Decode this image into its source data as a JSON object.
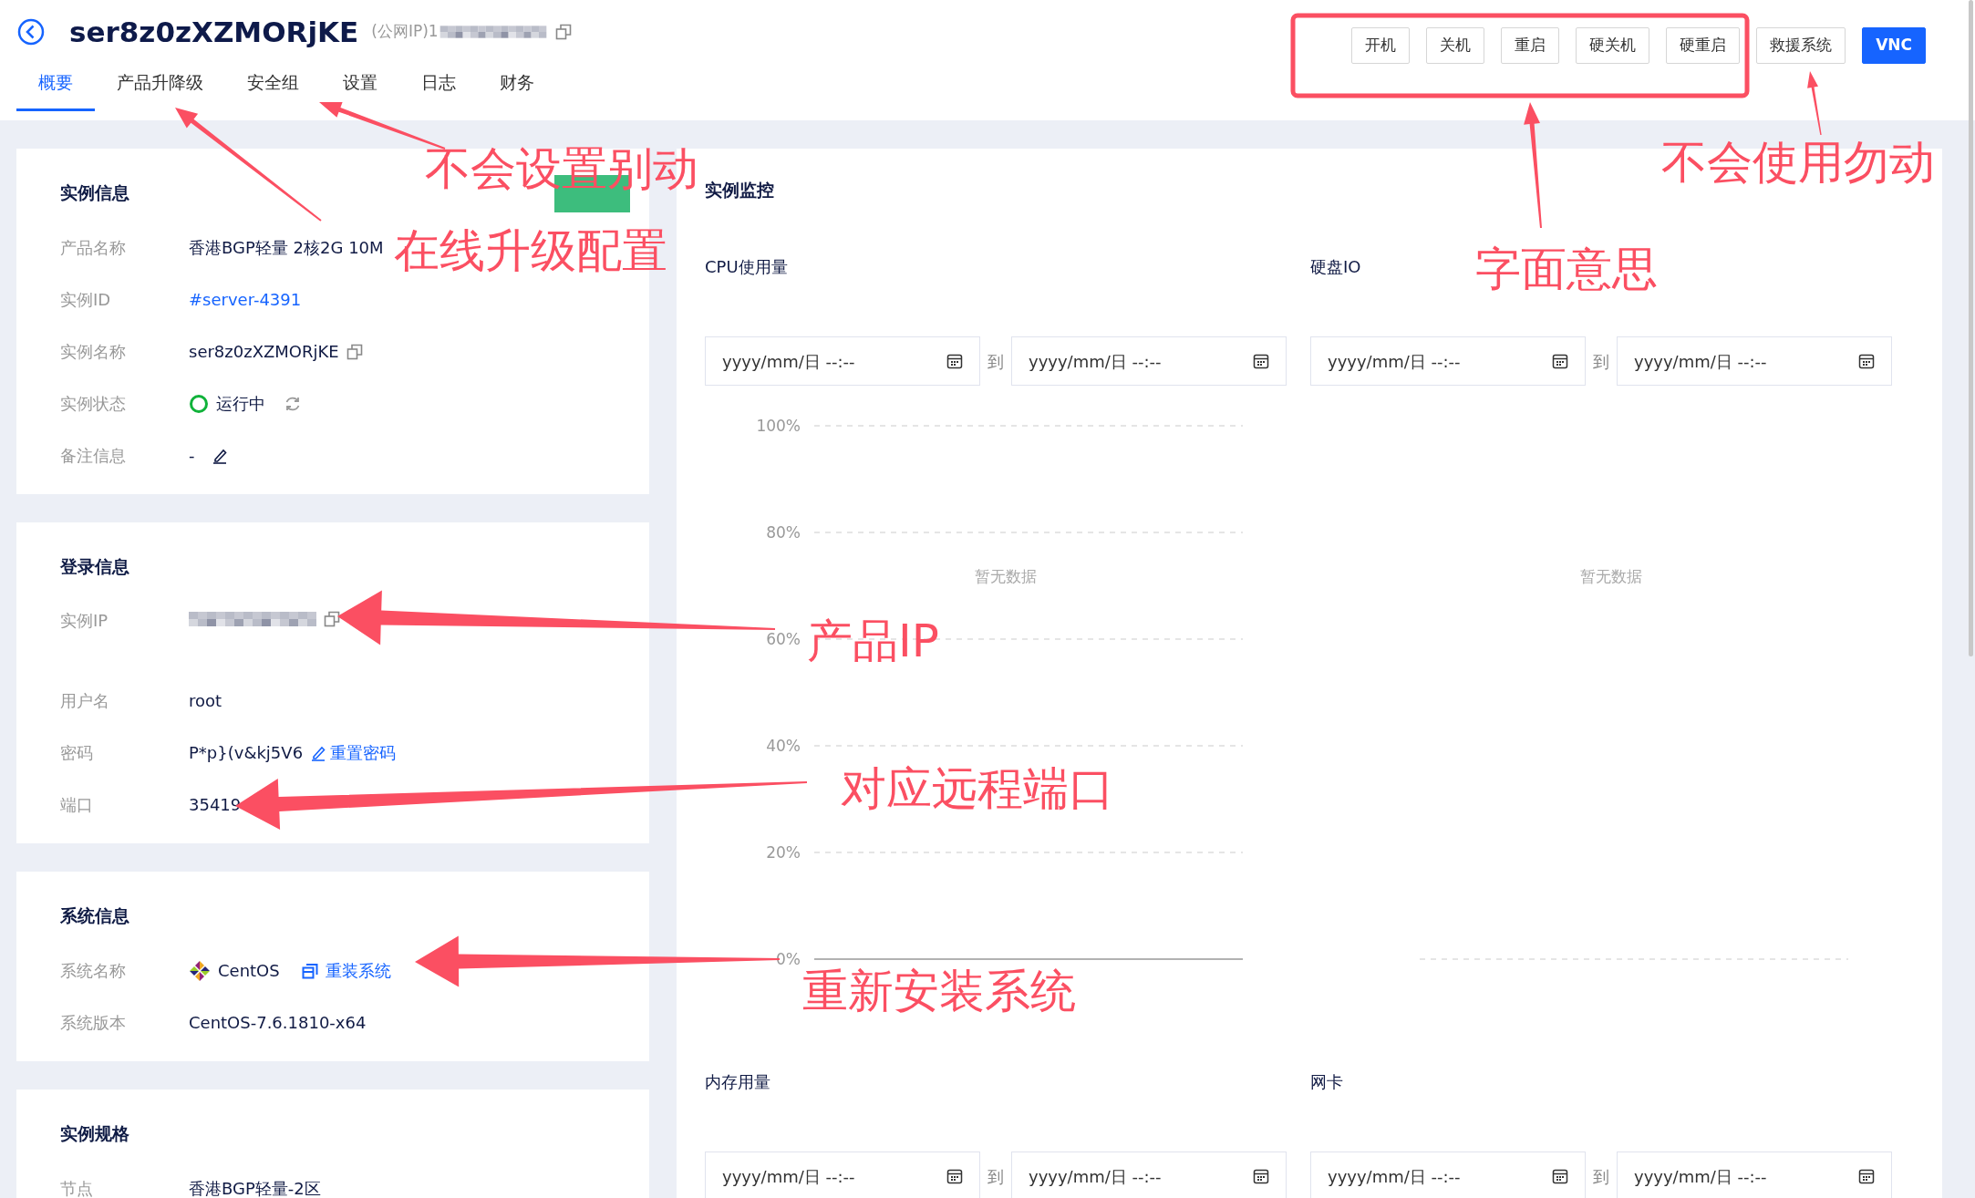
{
  "header": {
    "title": "ser8z0zXZMORjKE",
    "subtitle": "(公网IP)1"
  },
  "tabs": [
    {
      "label": "概要",
      "selected": true
    },
    {
      "label": "产品升降级",
      "selected": false
    },
    {
      "label": "安全组",
      "selected": false
    },
    {
      "label": "设置",
      "selected": false
    },
    {
      "label": "日志",
      "selected": false
    },
    {
      "label": "财务",
      "selected": false
    }
  ],
  "actions": [
    {
      "label": "开机",
      "kind": "default"
    },
    {
      "label": "关机",
      "kind": "default"
    },
    {
      "label": "重启",
      "kind": "default"
    },
    {
      "label": "硬关机",
      "kind": "default"
    },
    {
      "label": "硬重启",
      "kind": "default"
    },
    {
      "label": "救援系统",
      "kind": "default"
    },
    {
      "label": "VNC",
      "kind": "primary"
    }
  ],
  "cards": [
    {
      "title": "实例信息",
      "badge": true,
      "rows": [
        {
          "label": "产品名称",
          "kind": "text",
          "value": "香港BGP轻量 2核2G 10M"
        },
        {
          "label": "实例ID",
          "kind": "link",
          "value": "#server-4391"
        },
        {
          "label": "实例名称",
          "kind": "copy",
          "value": "ser8z0zXZMORjKE"
        },
        {
          "label": "实例状态",
          "kind": "status",
          "value": "运行中",
          "active": true
        },
        {
          "label": "备注信息",
          "kind": "edit",
          "value": "-"
        }
      ]
    },
    {
      "title": "登录信息",
      "rows": [
        {
          "label": "实例IP",
          "kind": "blurred"
        },
        {
          "label": "用户名",
          "kind": "text",
          "value": "root"
        },
        {
          "label": "密码",
          "kind": "password",
          "value": "P*p}(v&kj5V6",
          "action": "重置密码"
        },
        {
          "label": "端口",
          "kind": "text",
          "value": "35419"
        }
      ]
    },
    {
      "title": "系统信息",
      "rows": [
        {
          "label": "系统名称",
          "kind": "os",
          "value": "CentOS",
          "action": "重装系统"
        },
        {
          "label": "系统版本",
          "kind": "text",
          "value": "CentOS-7.6.1810-x64"
        }
      ]
    },
    {
      "title": "实例规格",
      "rows": [
        {
          "label": "节点",
          "kind": "text",
          "value": "香港BGP轻量-2区"
        }
      ]
    }
  ],
  "monitor": {
    "title": "实例监控",
    "panels": [
      {
        "title": "CPU使用量",
        "range": {
          "from": "yyyy/mm/日 --:--",
          "separator": "到",
          "to": "yyyy/mm/日 --:--"
        },
        "empty_text": "暂无数据",
        "axis_labels": [
          "100%",
          "80%",
          "60%",
          "40%",
          "20%",
          "0%"
        ]
      },
      {
        "title": "硬盘IO",
        "range": {
          "from": "yyyy/mm/日 --:--",
          "separator": "到",
          "to": "yyyy/mm/日 --:--"
        },
        "empty_text": "暂无数据"
      },
      {
        "title": "内存用量",
        "range": {
          "from": "yyyy/mm/日 --:--",
          "separator": "到",
          "to": "yyyy/mm/日 --:--"
        }
      },
      {
        "title": "网卡",
        "range": {
          "from": "yyyy/mm/日 --:--",
          "separator": "到",
          "to": "yyyy/mm/日 --:--"
        }
      }
    ]
  },
  "annotations": [
    {
      "text": "不会设置别动"
    },
    {
      "text": "在线升级配置"
    },
    {
      "text": "字面意思"
    },
    {
      "text": "不会使用勿动"
    },
    {
      "text": "产品IP"
    },
    {
      "text": "对应远程端口"
    },
    {
      "text": "重新安装系统"
    }
  ]
}
